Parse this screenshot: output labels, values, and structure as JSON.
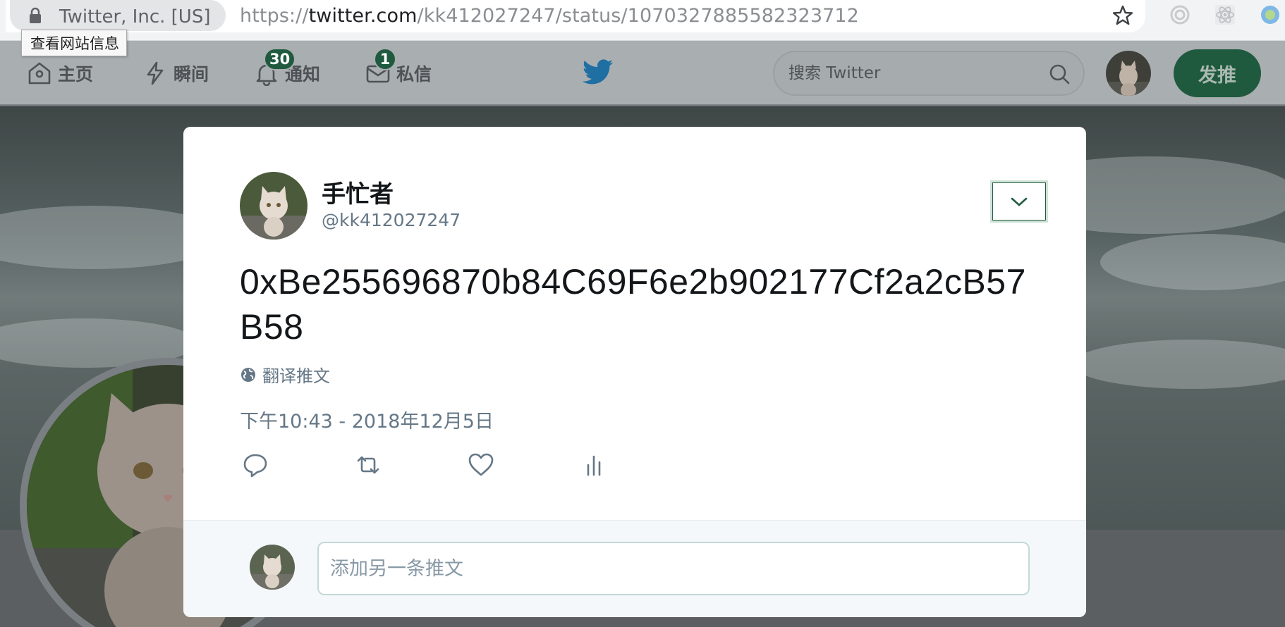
{
  "browser": {
    "site_identity": "Twitter, Inc. [US]",
    "url_scheme": "https://",
    "url_host": "twitter.com",
    "url_path": "/kk412027247/status/1070327885582323712",
    "tooltip": "查看网站信息"
  },
  "nav": {
    "home_label": "主页",
    "moments_label": "瞬间",
    "notifications_label": "通知",
    "notifications_badge": "30",
    "messages_label": "私信",
    "messages_badge": "1",
    "search_placeholder": "搜索 Twitter",
    "tweet_button_label": "发推"
  },
  "tweet": {
    "author_name": "手忙者",
    "author_handle": "@kk412027247",
    "text": "0xBe255696870b84C69F6e2b902177Cf2a2cB57B58",
    "translate_label": "翻译推文",
    "timestamp": "下午10:43 - 2018年12月5日"
  },
  "reply": {
    "placeholder": "添加另一条推文"
  },
  "colors": {
    "accent": "#1f5a3e",
    "text_secondary": "#657786",
    "text_primary": "#14171a"
  },
  "icons": {
    "lock": "lock-icon",
    "star": "star-icon",
    "home": "home-icon",
    "moments": "lightning-icon",
    "notifications": "bell-icon",
    "messages": "envelope-icon",
    "logo": "twitter-bird-icon",
    "search": "search-icon",
    "caret": "chevron-down-icon",
    "translate": "globe-icon",
    "reply": "reply-icon",
    "retweet": "retweet-icon",
    "like": "heart-icon",
    "analytics": "analytics-icon"
  }
}
